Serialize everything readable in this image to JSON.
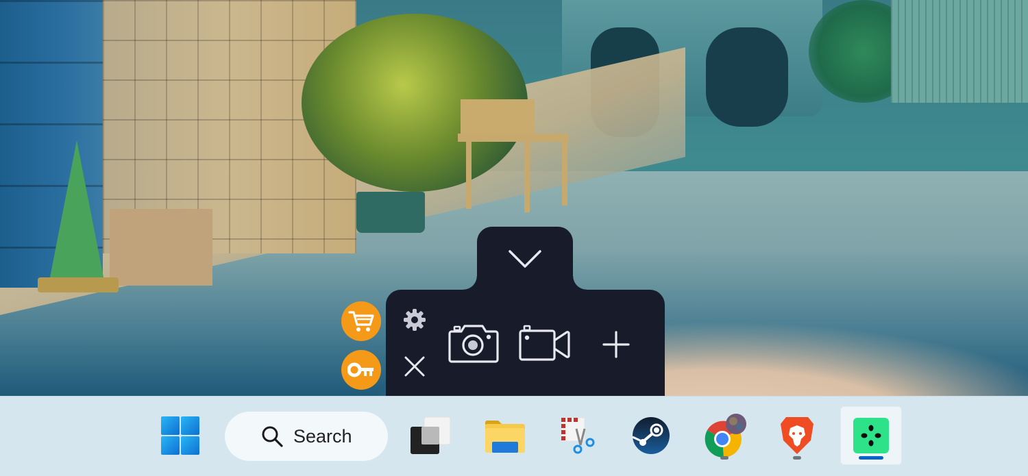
{
  "desktop": {
    "wallpaper": "anime street scene with tiled wall, potted plant, traffic cone, cardboard box and parked car"
  },
  "capture_toolbar": {
    "accent_color": "#171b2a",
    "icon_color": "#e8e8f0",
    "buttons": [
      {
        "id": "collapse",
        "icon": "chevron-down-icon",
        "label": "Collapse"
      },
      {
        "id": "settings",
        "icon": "gear-icon",
        "label": "Settings"
      },
      {
        "id": "close",
        "icon": "close-icon",
        "label": "Close"
      },
      {
        "id": "screenshot",
        "icon": "camera-icon",
        "label": "Screenshot"
      },
      {
        "id": "record",
        "icon": "video-camera-icon",
        "label": "Record video"
      },
      {
        "id": "add",
        "icon": "plus-icon",
        "label": "Add"
      }
    ],
    "side_buttons": [
      {
        "id": "buy",
        "icon": "shopping-cart-icon",
        "color": "#f59a18"
      },
      {
        "id": "license",
        "icon": "key-icon",
        "color": "#f59a18"
      }
    ]
  },
  "taskbar": {
    "background": "#d6e6ee",
    "search_label": "Search",
    "items": [
      {
        "name": "Start",
        "icon": "windows-logo-icon",
        "running": false,
        "active": false
      },
      {
        "name": "Task View",
        "icon": "task-view-icon",
        "running": false,
        "active": false
      },
      {
        "name": "File Explorer",
        "icon": "folder-icon",
        "running": false,
        "active": false
      },
      {
        "name": "Snipping Tool",
        "icon": "snipping-tool-icon",
        "running": false,
        "active": false
      },
      {
        "name": "Steam",
        "icon": "steam-icon",
        "running": false,
        "active": false
      },
      {
        "name": "Google Chrome",
        "icon": "chrome-icon",
        "running": true,
        "active": false
      },
      {
        "name": "Brave",
        "icon": "brave-icon",
        "running": true,
        "active": false
      },
      {
        "name": "Screen Recorder",
        "icon": "green-app-icon",
        "running": true,
        "active": true
      }
    ]
  }
}
